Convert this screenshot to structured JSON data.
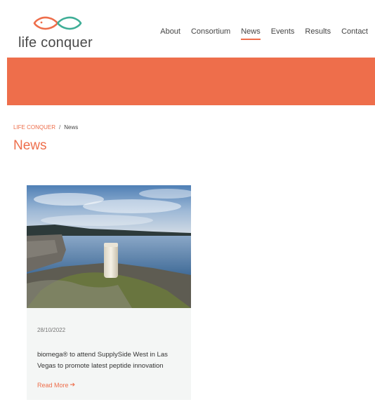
{
  "brand": {
    "name": "life conquer",
    "logo_icon": "fish-infinity-icon",
    "logo_colors": {
      "left": "#ee6e4b",
      "right": "#3fae97"
    }
  },
  "nav": {
    "items": [
      {
        "label": "About",
        "active": false
      },
      {
        "label": "Consortium",
        "active": false
      },
      {
        "label": "News",
        "active": true
      },
      {
        "label": "Events",
        "active": false
      },
      {
        "label": "Results",
        "active": false
      },
      {
        "label": "Contact",
        "active": false
      }
    ]
  },
  "colors": {
    "accent": "#ee6e4b",
    "card_bg": "#f4f6f5"
  },
  "breadcrumb": {
    "home": "LIFE CONQUER",
    "separator": "/",
    "current": "News"
  },
  "page_title": "News",
  "posts": [
    {
      "date": "28/10/2022",
      "title": "biomega® to attend SupplySide West in Las Vegas to promote latest peptide innovation",
      "read_more": "Read More",
      "read_more_icon": "arrow-right-icon"
    }
  ]
}
